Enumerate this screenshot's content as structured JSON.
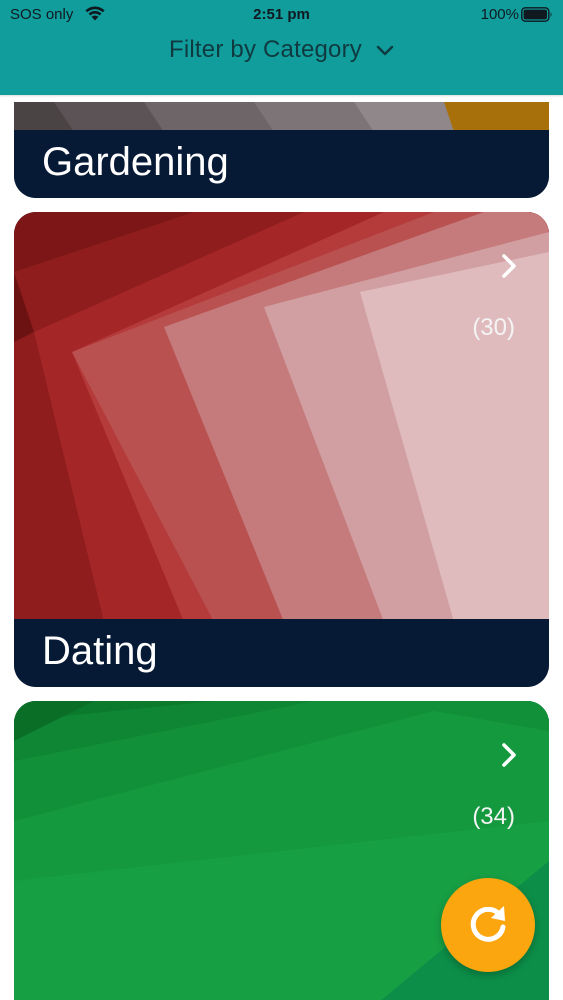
{
  "status_bar": {
    "carrier": "SOS only",
    "time": "2:51 pm",
    "battery": "100%"
  },
  "header": {
    "filter_label": "Filter by Category",
    "icon": "chevron-down-icon",
    "background": "#119d9c"
  },
  "categories": [
    {
      "name": "Gardening",
      "count": "",
      "accent": "#6b6466"
    },
    {
      "name": "Dating",
      "count": "(30)",
      "accent": "#b02a2a"
    },
    {
      "name": "",
      "count": "(34)",
      "accent": "#0f8a3a"
    }
  ],
  "fab": {
    "icon": "refresh-icon",
    "color": "#fba50f"
  },
  "colors": {
    "card_footer": "#061a36",
    "text_on_card": "#ffffff"
  }
}
